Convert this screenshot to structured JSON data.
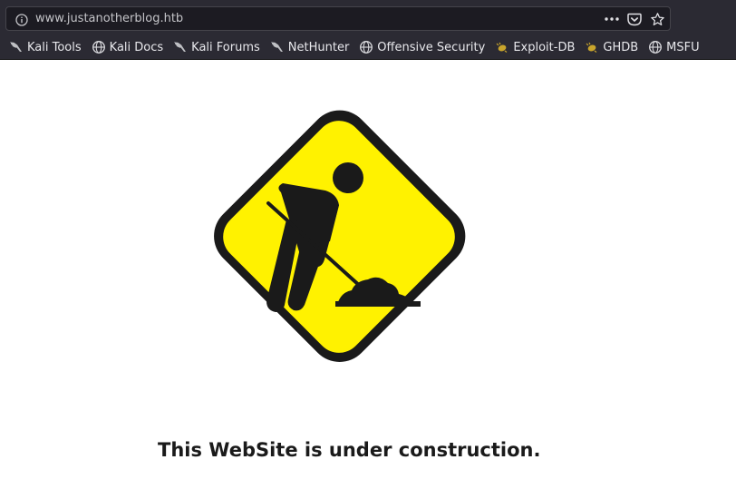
{
  "browser": {
    "url": "www.justanotherblog.htb",
    "info_icon": "info-icon",
    "actions": [
      {
        "name": "page-actions-button",
        "icon": "more-dots-icon"
      },
      {
        "name": "pocket-button",
        "icon": "pocket-icon"
      },
      {
        "name": "bookmark-star-button",
        "icon": "star-icon"
      }
    ]
  },
  "bookmarks": [
    {
      "label": "Kali Tools",
      "icon": "kali-dragon-icon"
    },
    {
      "label": "Kali Docs",
      "icon": "globe-icon"
    },
    {
      "label": "Kali Forums",
      "icon": "kali-dragon-icon"
    },
    {
      "label": "NetHunter",
      "icon": "kali-dragon-icon"
    },
    {
      "label": "Offensive Security",
      "icon": "globe-icon"
    },
    {
      "label": "Exploit-DB",
      "icon": "exploitdb-bug-icon"
    },
    {
      "label": "GHDB",
      "icon": "exploitdb-bug-icon"
    },
    {
      "label": "MSFU",
      "icon": "globe-icon"
    }
  ],
  "page": {
    "sign_icon": "under-construction-sign-icon",
    "caption": "This WebSite is under construction."
  },
  "colors": {
    "toolbar": "#2b2a33",
    "urlbar": "#1c1b22",
    "sign_yellow": "#fff200",
    "sign_border": "#1a1a1a"
  }
}
